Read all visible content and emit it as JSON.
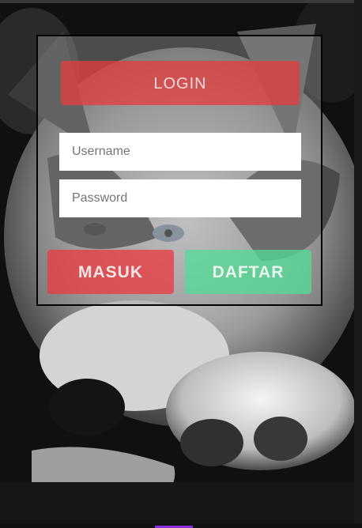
{
  "login_form": {
    "title_label": "LOGIN",
    "username": {
      "value": "",
      "placeholder": "Username"
    },
    "password": {
      "value": "",
      "placeholder": "Password"
    },
    "submit_label": "MASUK",
    "register_label": "DAFTAR"
  },
  "colors": {
    "login_button": "#e63c3c",
    "masuk_button": "#eb3c41",
    "daftar_button": "#50dc96",
    "input_background": "#ffffff",
    "card_border": "#000000"
  }
}
